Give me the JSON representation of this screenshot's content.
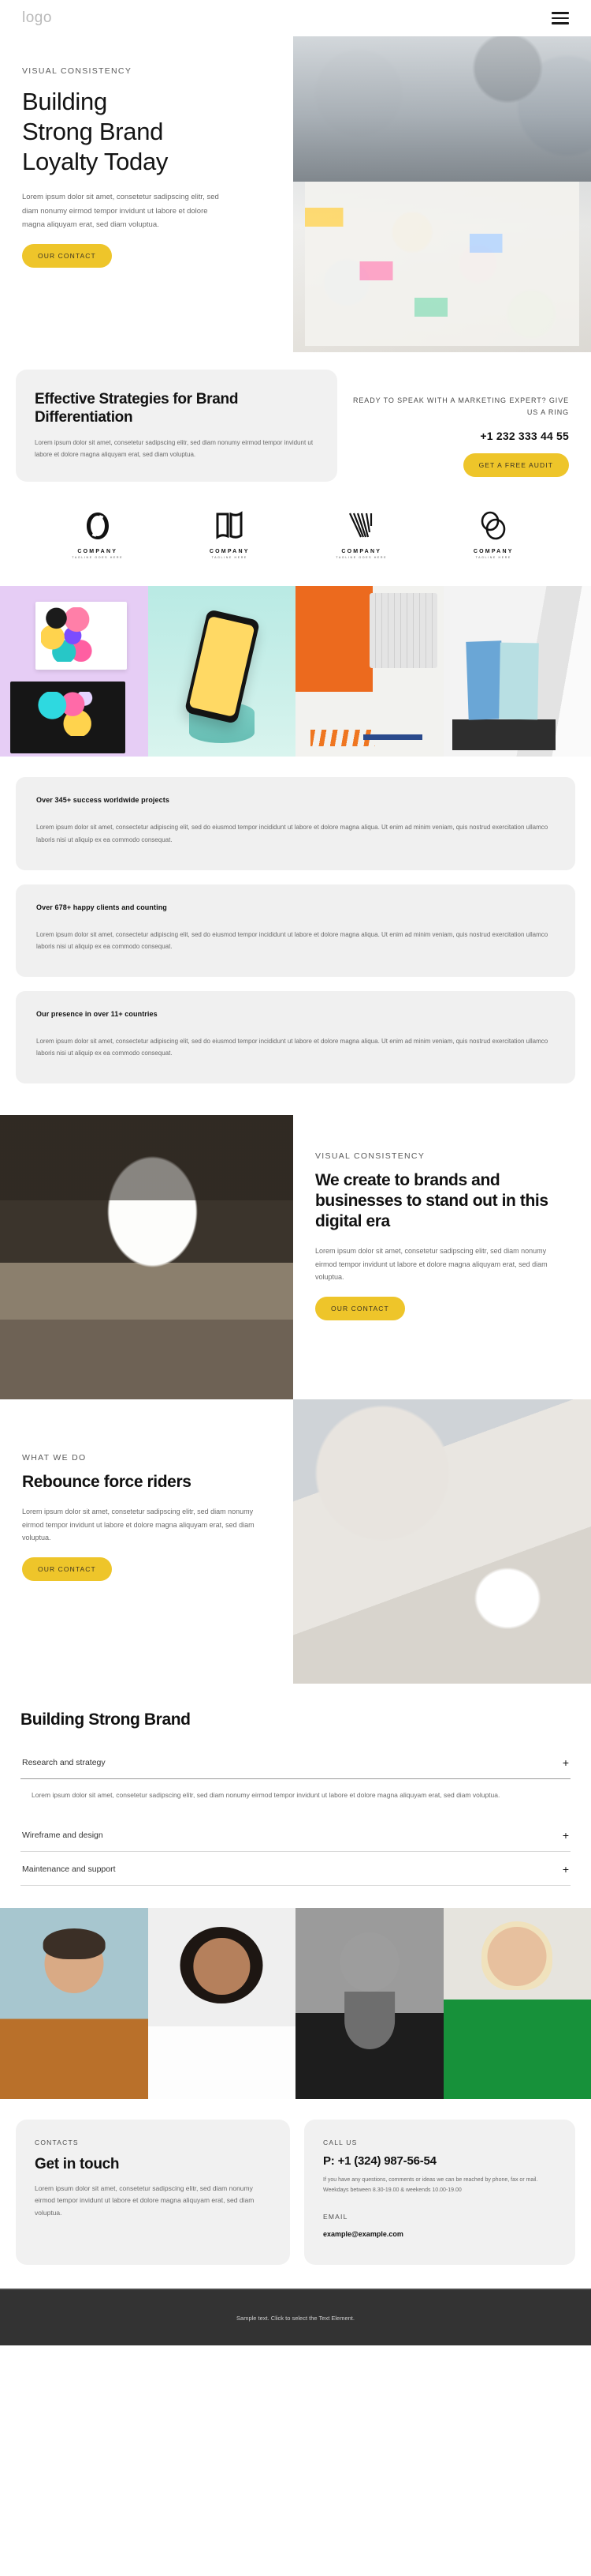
{
  "header": {
    "logo": "logo",
    "menu_icon": "hamburger-menu-icon"
  },
  "hero": {
    "eyebrow": "VISUAL CONSISTENCY",
    "title_lines": [
      "Building",
      "Strong Brand",
      "Loyalty Today"
    ],
    "body": "Lorem ipsum dolor sit amet, consetetur sadipscing elitr, sed diam nonumy eirmod tempor invidunt ut labore et dolore magna aliquyam erat, sed diam voluptua.",
    "cta": "OUR CONTACT"
  },
  "strategy": {
    "title": "Effective Strategies for Brand Differentiation",
    "body": "Lorem ipsum dolor sit amet, consetetur sadipscing elitr, sed diam nonumy eirmod tempor invidunt ut labore et dolore magna aliquyam erat, sed diam voluptua.",
    "ring_label": "READY TO SPEAK WITH A MARKETING EXPERT? GIVE US A RING",
    "phone": "+1 232 333 44 55",
    "cta": "GET A FREE AUDIT"
  },
  "brands": [
    {
      "name": "COMPANY",
      "tagline": "TAGLINE GOES HERE",
      "icon": "infinity-loop-logo-icon"
    },
    {
      "name": "COMPANY",
      "tagline": "TAGLINE HERE",
      "icon": "open-book-logo-icon"
    },
    {
      "name": "COMPANY",
      "tagline": "TAGLINE GOES HERE",
      "icon": "striped-v-logo-icon"
    },
    {
      "name": "COMPANY",
      "tagline": "TAGLINE HERE",
      "icon": "double-oval-logo-icon"
    }
  ],
  "gallery": [
    {
      "name": "branding-stationery-image"
    },
    {
      "name": "phone-mockup-image"
    },
    {
      "name": "desk-flatlay-image"
    },
    {
      "name": "paper-samples-image"
    }
  ],
  "stats": [
    {
      "title": "Over 345+ success worldwide projects",
      "body": "Lorem ipsum dolor sit amet, consectetur adipiscing elit, sed do eiusmod tempor incididunt ut labore et dolore magna aliqua. Ut enim ad minim veniam, quis nostrud exercitation ullamco laboris nisi ut aliquip ex ea commodo consequat."
    },
    {
      "title": "Over 678+ happy clients and counting",
      "body": "Lorem ipsum dolor sit amet, consectetur adipiscing elit, sed do eiusmod tempor incididunt ut labore et dolore magna aliqua. Ut enim ad minim veniam, quis nostrud exercitation ullamco laboris nisi ut aliquip ex ea commodo consequat."
    },
    {
      "title": "Our presence in over 11+ countries",
      "body": "Lorem ipsum dolor sit amet, consectetur adipiscing elit, sed do eiusmod tempor incididunt ut labore et dolore magna aliqua. Ut enim ad minim veniam, quis nostrud exercitation ullamco laboris nisi ut aliquip ex ea commodo consequat."
    }
  ],
  "create_section": {
    "eyebrow": "VISUAL CONSISTENCY",
    "title": "We create to brands and businesses to stand out in this digital era",
    "body": "Lorem ipsum dolor sit amet, consetetur sadipscing elitr, sed diam nonumy eirmod tempor invidunt ut labore et dolore magna aliquyam erat, sed diam voluptua.",
    "cta": "OUR CONTACT",
    "image_name": "team-reviewing-color-swatches-image"
  },
  "rebounce_section": {
    "eyebrow": "WHAT WE DO",
    "title": "Rebounce force riders",
    "body": "Lorem ipsum dolor sit amet, consetetur sadipscing elitr, sed diam nonumy eirmod tempor invidunt ut labore et dolore magna aliquyam erat, sed diam voluptua.",
    "cta": "OUR CONTACT",
    "image_name": "hands-on-documents-with-coffee-image"
  },
  "accordion": {
    "heading": "Building Strong Brand",
    "items": [
      {
        "label": "Research and strategy",
        "expanded": true,
        "panel": "Lorem ipsum dolor sit amet, consetetur sadipscing elitr, sed diam nonumy eirmod tempor invidunt ut labore et dolore magna aliquyam erat, sed diam voluptua.",
        "toggle": "+"
      },
      {
        "label": "Wireframe and design",
        "expanded": false,
        "panel": "",
        "toggle": "+"
      },
      {
        "label": "Maintenance and support",
        "expanded": false,
        "panel": "",
        "toggle": "+"
      }
    ]
  },
  "team": [
    {
      "name": "team-member-photo-1"
    },
    {
      "name": "team-member-photo-2"
    },
    {
      "name": "team-member-photo-3"
    },
    {
      "name": "team-member-photo-4"
    }
  ],
  "contact": {
    "left": {
      "eyebrow": "CONTACTS",
      "title": "Get in touch",
      "body": "Lorem ipsum dolor sit amet, consetetur sadipscing elitr, sed diam nonumy eirmod tempor invidunt ut labore et dolore magna aliquyam erat, sed diam voluptua."
    },
    "right": {
      "eyebrow": "CALL US",
      "phone": "P: +1 (324) 987-56-54",
      "note": "If you have any questions, comments or ideas we can be reached by phone, fax or mail. Weekdays between 8.30-19.00 & weekends 10.00-19.00",
      "email_label": "EMAIL",
      "email": "example@example.com"
    }
  },
  "footer": {
    "text": "Sample text. Click to select the Text Element."
  },
  "colors": {
    "accent": "#eec52a",
    "card_bg": "#f1f1f1",
    "footer_bg": "#333333",
    "text": "#1a1a1a"
  }
}
